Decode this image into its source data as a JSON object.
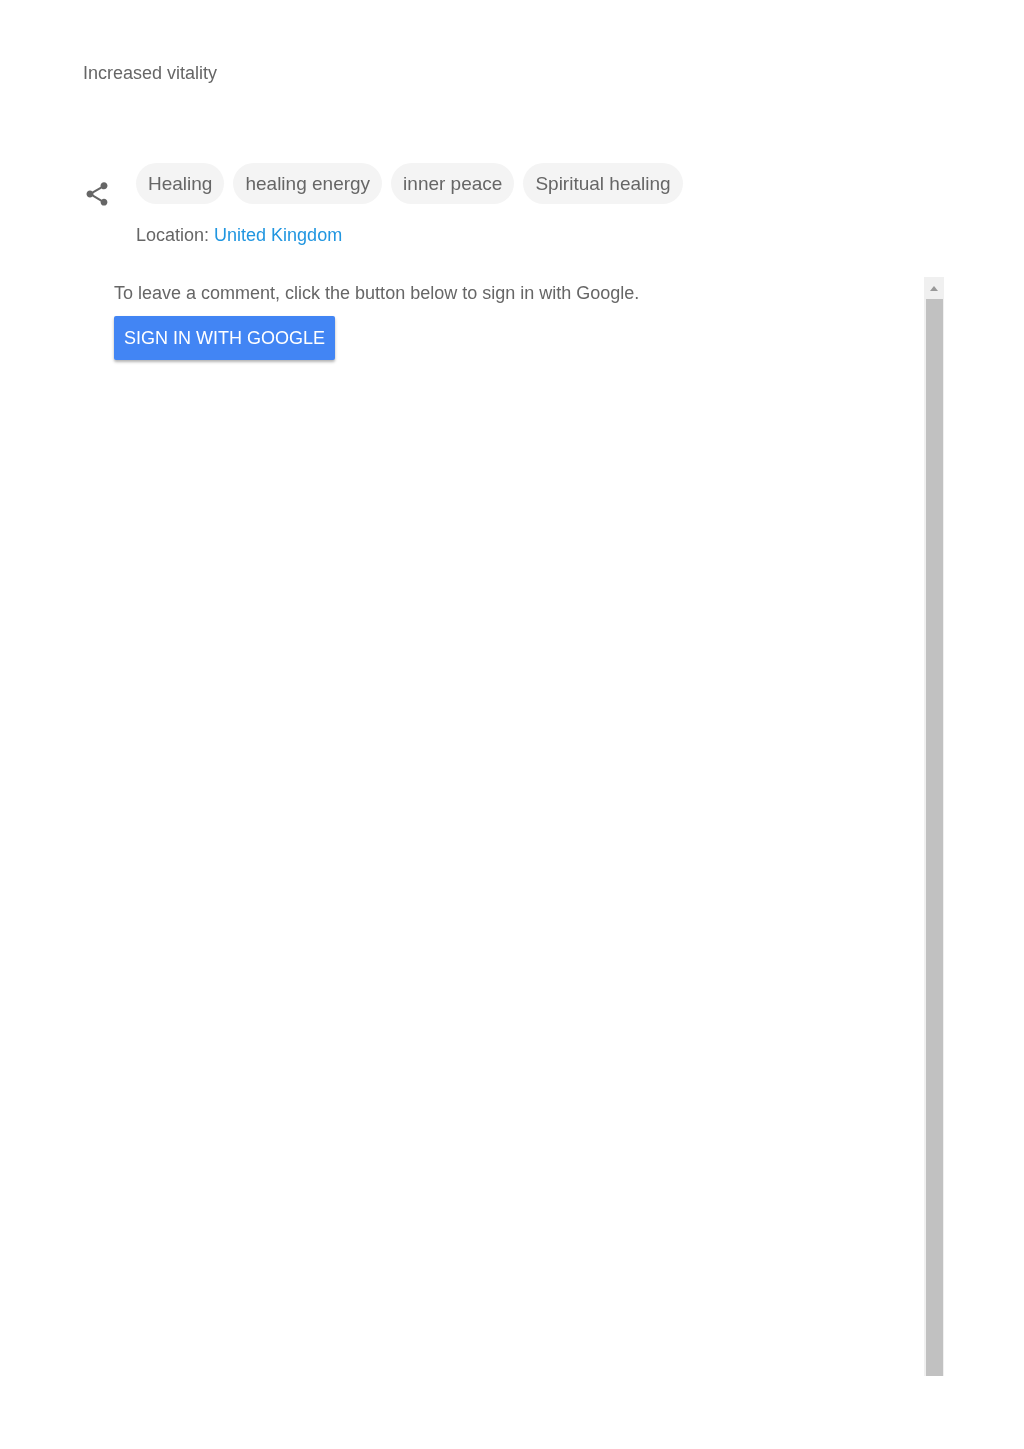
{
  "heading": "Increased vitality",
  "tags": [
    {
      "label": "Healing"
    },
    {
      "label": "healing energy"
    },
    {
      "label": "inner peace"
    },
    {
      "label": "Spiritual healing"
    }
  ],
  "location": {
    "label": "Location:",
    "link": "United Kingdom"
  },
  "comments": {
    "prompt": "To leave a comment, click the button below to sign in with Google.",
    "button": "SIGN IN WITH GOOGLE"
  }
}
